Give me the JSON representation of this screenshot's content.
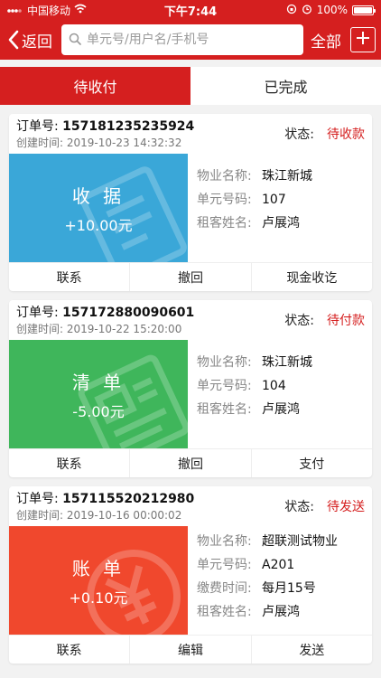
{
  "status_bar": {
    "carrier": "中国移动",
    "time": "下午7:44",
    "battery": "100%"
  },
  "nav": {
    "back_label": "返回",
    "search_placeholder": "单元号/用户名/手机号",
    "all_label": "全部"
  },
  "tabs": [
    {
      "label": "待收付",
      "active": true
    },
    {
      "label": "已完成",
      "active": false
    }
  ],
  "labels": {
    "order_no": "订单号:",
    "created": "创建时间:",
    "status": "状态:"
  },
  "colors": {
    "accent": "#d51f1f",
    "receipt": "#3aa7d8",
    "statement": "#3fb65b",
    "bill": "#f0482d"
  },
  "orders": [
    {
      "order_no": "157181235235924",
      "created": "2019-10-23 14:32:32",
      "status": "待收款",
      "badge_title": "收 据",
      "badge_amount": "+10.00元",
      "badge_color": "#3aa7d8",
      "watermark_icon": "receipt-icon",
      "info": [
        {
          "label": "物业名称:",
          "value": "珠江新城"
        },
        {
          "label": "单元号码:",
          "value": "107"
        },
        {
          "label": "租客姓名:",
          "value": "卢展鸿"
        }
      ],
      "actions": [
        "联系",
        "撤回",
        "现金收讫"
      ]
    },
    {
      "order_no": "157172880090601",
      "created": "2019-10-22 15:20:00",
      "status": "待付款",
      "badge_title": "清 单",
      "badge_amount": "-5.00元",
      "badge_color": "#3fb65b",
      "watermark_icon": "list-icon",
      "info": [
        {
          "label": "物业名称:",
          "value": "珠江新城"
        },
        {
          "label": "单元号码:",
          "value": "104"
        },
        {
          "label": "租客姓名:",
          "value": "卢展鸿"
        }
      ],
      "actions": [
        "联系",
        "撤回",
        "支付"
      ]
    },
    {
      "order_no": "157115520212980",
      "created": "2019-10-16 00:00:02",
      "status": "待发送",
      "badge_title": "账 单",
      "badge_amount": "+0.10元",
      "badge_color": "#f0482d",
      "watermark_icon": "yen-icon",
      "info": [
        {
          "label": "物业名称:",
          "value": "超联测试物业"
        },
        {
          "label": "单元号码:",
          "value": "A201"
        },
        {
          "label": "缴费时间:",
          "value": "每月15号"
        },
        {
          "label": "租客姓名:",
          "value": "卢展鸿"
        }
      ],
      "actions": [
        "联系",
        "编辑",
        "发送"
      ]
    }
  ]
}
